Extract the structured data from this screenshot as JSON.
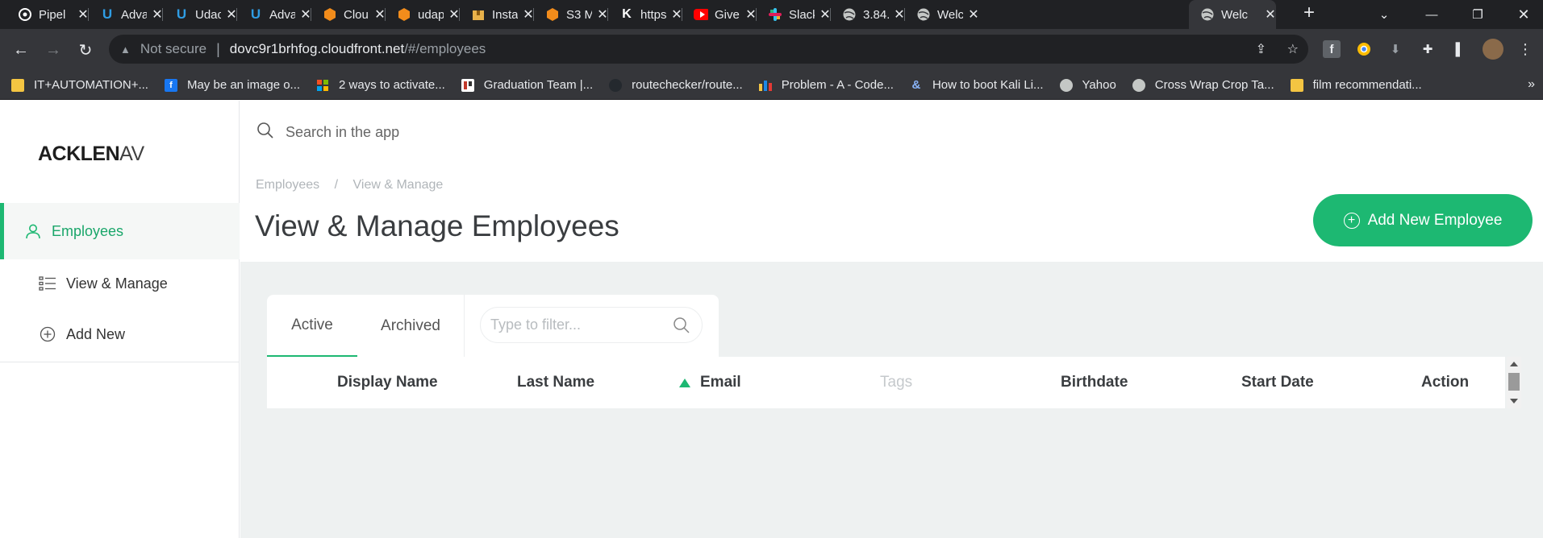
{
  "browser": {
    "tabs": [
      {
        "title": "Pipel",
        "icon": "pipeline-icon",
        "color": "#ffffff"
      },
      {
        "title": "Adva",
        "icon": "udacity-icon",
        "color": "#2f9de4"
      },
      {
        "title": "Udac",
        "icon": "udacity-icon",
        "color": "#2f9de4"
      },
      {
        "title": "Adva",
        "icon": "udacity-icon",
        "color": "#2f9de4"
      },
      {
        "title": "Clou",
        "icon": "aws-icon",
        "color": "#f28c1b"
      },
      {
        "title": "udap",
        "icon": "aws-icon",
        "color": "#f28c1b"
      },
      {
        "title": "Insta",
        "icon": "package-icon",
        "color": "#e8b14a"
      },
      {
        "title": "S3 M",
        "icon": "aws-icon",
        "color": "#f28c1b"
      },
      {
        "title": "https",
        "icon": "k-icon",
        "color": "#ffffff"
      },
      {
        "title": "Give",
        "icon": "youtube-icon",
        "color": "#ff0000"
      },
      {
        "title": "Slack",
        "icon": "slack-icon",
        "color": "#e01e5a"
      },
      {
        "title": "3.84.",
        "icon": "globe-icon",
        "color": "#c4c7c5"
      },
      {
        "title": "Welc",
        "icon": "globe-icon",
        "color": "#c4c7c5"
      },
      {
        "title": "Welc",
        "icon": "globe-icon",
        "color": "#c4c7c5"
      }
    ],
    "address": {
      "security": "Not secure",
      "host": "dovc9r1brhfog.cloudfront.net",
      "path": "/#/employees"
    },
    "bookmarks": [
      {
        "label": "IT+AUTOMATION+...",
        "icon": "folder-icon",
        "color": "#f4c542"
      },
      {
        "label": "May be an image o...",
        "icon": "facebook-icon",
        "color": "#1877f2"
      },
      {
        "label": "2 ways to activate...",
        "icon": "microsoft-icon",
        "color": "#f25022"
      },
      {
        "label": "Graduation Team |...",
        "icon": "trello-icon",
        "color": "#ffffff"
      },
      {
        "label": "routechecker/route...",
        "icon": "github-icon",
        "color": "#24292e"
      },
      {
        "label": "Problem - A - Code...",
        "icon": "codeforces-icon",
        "color": "#f4c542"
      },
      {
        "label": "How to boot Kali Li...",
        "icon": "ampersand-icon",
        "color": "#8ab4f8"
      },
      {
        "label": "Yahoo",
        "icon": "globe-icon",
        "color": "#c4c7c5"
      },
      {
        "label": "Cross Wrap Crop Ta...",
        "icon": "globe-icon",
        "color": "#c4c7c5"
      },
      {
        "label": "film recommendati...",
        "icon": "folder-icon",
        "color": "#f4c542"
      }
    ]
  },
  "app": {
    "logo": {
      "main": "ACKLEN",
      "faded": "AV"
    },
    "search_placeholder": "Search in the app",
    "sidebar": [
      {
        "label": "Employees",
        "icon": "user-icon",
        "active": true
      },
      {
        "label": "View & Manage",
        "icon": "list-icon",
        "active": false
      },
      {
        "label": "Add New",
        "icon": "plus-circle-icon",
        "active": false
      }
    ],
    "breadcrumb": [
      "Employees",
      "/",
      "View & Manage"
    ],
    "page_title": "View & Manage Employees",
    "add_button": "Add New Employee",
    "tabs": [
      "Active",
      "Archived"
    ],
    "filter_placeholder": "Type to filter...",
    "columns": [
      "Display Name",
      "Last Name",
      "Email",
      "Tags",
      "Birthdate",
      "Start Date",
      "Action"
    ],
    "sorted_column": "Email",
    "colors": {
      "accent": "#1db872",
      "content_bg": "#eef1f1"
    }
  }
}
